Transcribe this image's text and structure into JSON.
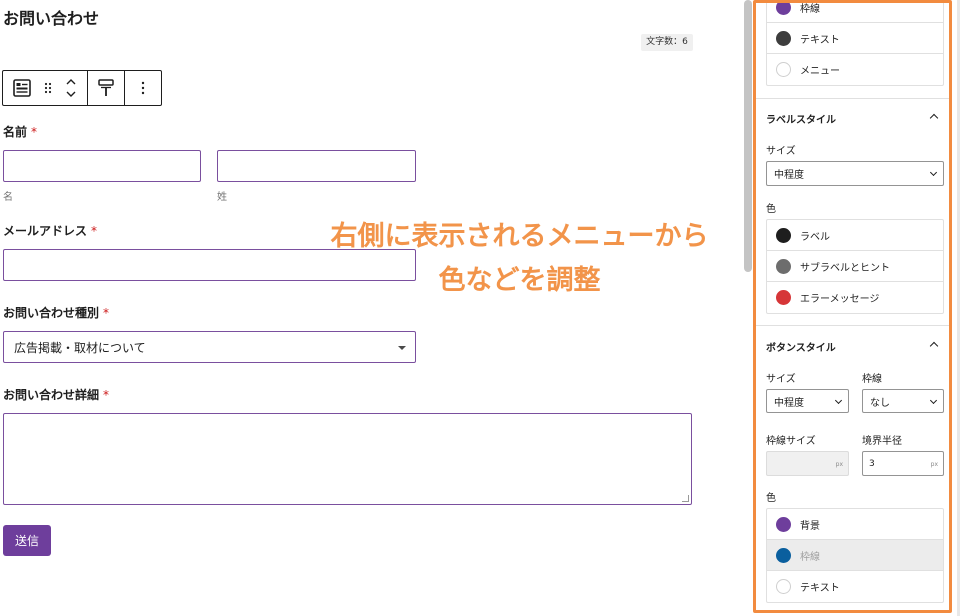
{
  "editor": {
    "page_title": "お問い合わせ",
    "char_count": "文字数：6",
    "fields": {
      "name_label": "名前",
      "name_first_sub": "名",
      "name_last_sub": "姓",
      "email_label": "メールアドレス",
      "type_label": "お問い合わせ種別",
      "type_selected": "広告掲載・取材について",
      "detail_label": "お問い合わせ詳細",
      "required_mark": "*"
    },
    "submit_label": "送信"
  },
  "annotation": {
    "line1": "右側に表示されるメニューから",
    "line2": "色などを調整"
  },
  "panel": {
    "top_colors": [
      {
        "label": "枠線",
        "color": "#6e3e9c"
      },
      {
        "label": "テキスト",
        "color": "#3d3d3d"
      },
      {
        "label": "メニュー",
        "color": "#ffffff"
      }
    ],
    "label_style": {
      "title": "ラベルスタイル",
      "size_label": "サイズ",
      "size_value": "中程度",
      "color_label": "色",
      "colors": [
        {
          "label": "ラベル",
          "color": "#1e1e1e"
        },
        {
          "label": "サブラベルとヒント",
          "color": "#6d6d6d"
        },
        {
          "label": "エラーメッセージ",
          "color": "#d63638"
        }
      ]
    },
    "button_style": {
      "title": "ボタンスタイル",
      "size_label": "サイズ",
      "size_value": "中程度",
      "border_label": "枠線",
      "border_value": "なし",
      "border_size_label": "枠線サイズ",
      "border_size_unit": "px",
      "radius_label": "境界半径",
      "radius_value": "3",
      "radius_unit": "px",
      "color_label": "色",
      "colors": [
        {
          "label": "背景",
          "color": "#6e3e9c"
        },
        {
          "label": "枠線",
          "color": "#0a5f9e"
        },
        {
          "label": "テキスト",
          "color": "#ffffff"
        }
      ]
    }
  }
}
